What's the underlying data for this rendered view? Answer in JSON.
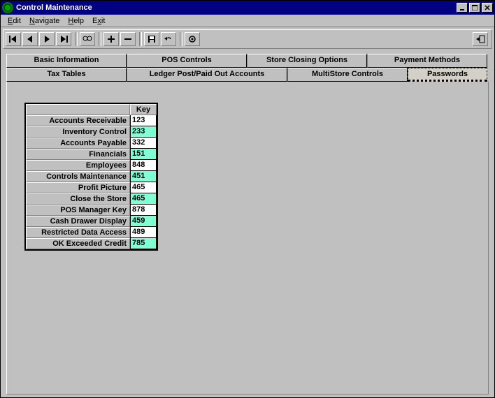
{
  "window": {
    "title": "Control Maintenance"
  },
  "menus": {
    "edit": "Edit",
    "navigate": "Navigate",
    "help": "Help",
    "exit": "Exit"
  },
  "tabs": {
    "row1": {
      "t0": "Basic Information",
      "t1": "POS Controls",
      "t2": "Store Closing Options",
      "t3": "Payment Methods"
    },
    "row2": {
      "t0": "Tax Tables",
      "t1": "Ledger Post/Paid Out Accounts",
      "t2": "MultiStore Controls",
      "t3": "Passwords"
    }
  },
  "table": {
    "header": "Key",
    "rows": [
      {
        "label": "Accounts Receivable",
        "key": "123",
        "hl": false
      },
      {
        "label": "Inventory Control",
        "key": "233",
        "hl": true
      },
      {
        "label": "Accounts Payable",
        "key": "332",
        "hl": false
      },
      {
        "label": "Financials",
        "key": "151",
        "hl": true
      },
      {
        "label": "Employees",
        "key": "848",
        "hl": false
      },
      {
        "label": "Controls Maintenance",
        "key": "451",
        "hl": true
      },
      {
        "label": "Profit Picture",
        "key": "465",
        "hl": false
      },
      {
        "label": "Close the Store",
        "key": "465",
        "hl": true
      },
      {
        "label": "POS Manager Key",
        "key": "878",
        "hl": false
      },
      {
        "label": "Cash Drawer Display",
        "key": "459",
        "hl": true
      },
      {
        "label": "Restricted Data Access",
        "key": "489",
        "hl": false
      },
      {
        "label": "OK Exceeded Credit",
        "key": "785",
        "hl": true
      }
    ]
  }
}
